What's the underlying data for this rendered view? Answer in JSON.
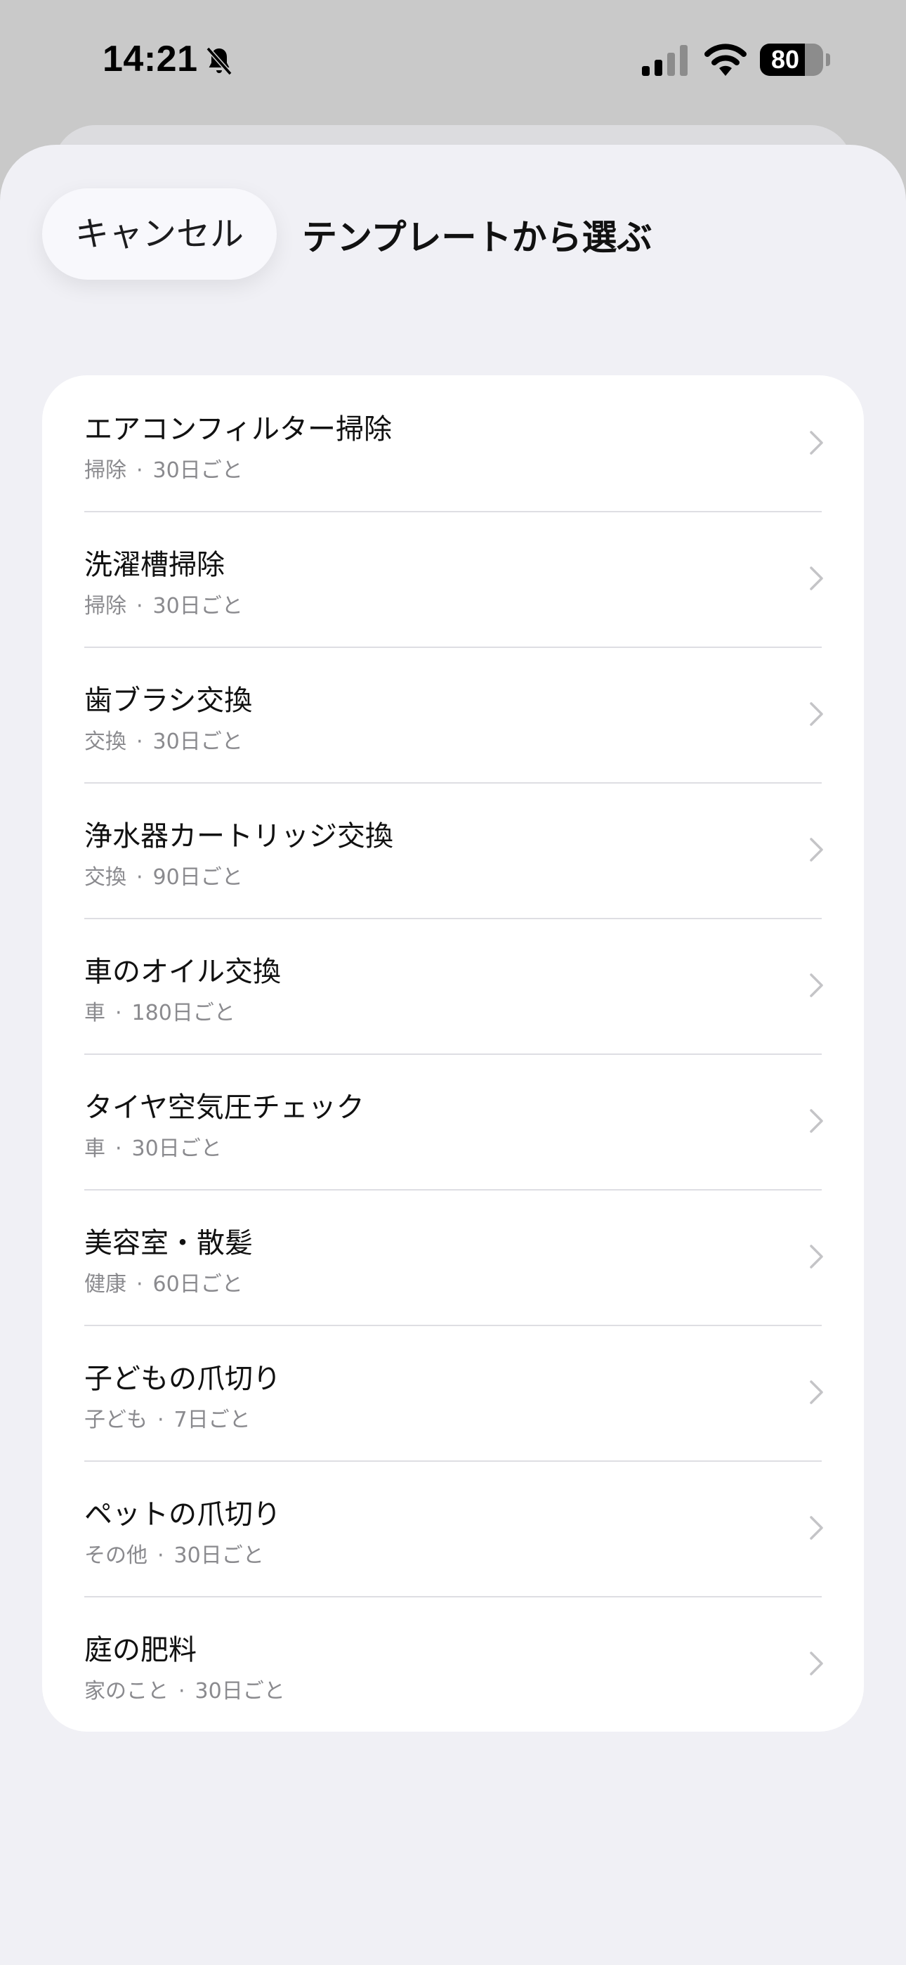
{
  "status_bar": {
    "time": "14:21",
    "battery_level": "80",
    "battery_fraction": 0.8,
    "icons": [
      "bell-slash-icon",
      "cellular-signal-icon",
      "wifi-icon",
      "battery-icon"
    ]
  },
  "header": {
    "cancel_label": "キャンセル",
    "title": "テンプレートから選ぶ"
  },
  "templates": [
    {
      "title": "エアコンフィルター掃除",
      "category": "掃除",
      "interval": "30日ごと"
    },
    {
      "title": "洗濯槽掃除",
      "category": "掃除",
      "interval": "30日ごと"
    },
    {
      "title": "歯ブラシ交換",
      "category": "交換",
      "interval": "30日ごと"
    },
    {
      "title": "浄水器カートリッジ交換",
      "category": "交換",
      "interval": "90日ごと"
    },
    {
      "title": "車のオイル交換",
      "category": "車",
      "interval": "180日ごと"
    },
    {
      "title": "タイヤ空気圧チェック",
      "category": "車",
      "interval": "30日ごと"
    },
    {
      "title": "美容室・散髪",
      "category": "健康",
      "interval": "60日ごと"
    },
    {
      "title": "子どもの爪切り",
      "category": "子ども",
      "interval": "7日ごと"
    },
    {
      "title": "ペットの爪切り",
      "category": "その他",
      "interval": "30日ごと"
    },
    {
      "title": "庭の肥料",
      "category": "家のこと",
      "interval": "30日ごと"
    }
  ],
  "separator": "·",
  "colors": {
    "sheet_background": "#f0f0f5",
    "card_background": "#ffffff",
    "secondary_text": "#8a8a8e",
    "chevron": "#c4c4c7"
  }
}
